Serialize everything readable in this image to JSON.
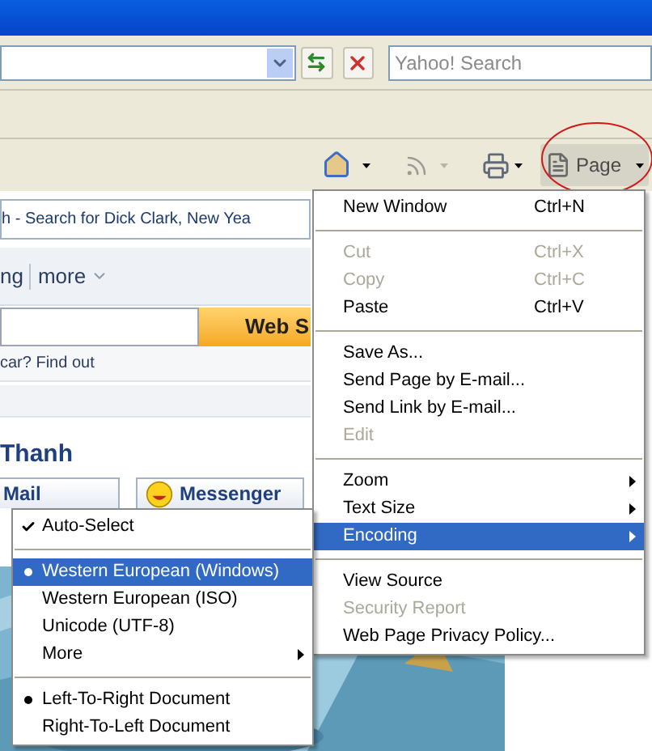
{
  "search_field": {
    "placeholder": "Yahoo! Search"
  },
  "command_bar": {
    "page_button": "Page"
  },
  "page": {
    "tab_title": "h - Search for Dick Clark, New Yea",
    "nav": [
      {
        "label": "ng"
      },
      {
        "label": "more"
      }
    ],
    "search_button": "Web S",
    "promo": "car? Find out",
    "greeting": "Thanh",
    "buttons": [
      {
        "label": "Mail",
        "kind": "mail"
      },
      {
        "label": "Messenger",
        "kind": "messenger"
      }
    ]
  },
  "menu": [
    {
      "kind": "item",
      "label": "New Window",
      "shortcut": "Ctrl+N",
      "disabled": false,
      "selected": false
    },
    {
      "kind": "separator"
    },
    {
      "kind": "item",
      "label": "Cut",
      "shortcut": "Ctrl+X",
      "disabled": true,
      "selected": false
    },
    {
      "kind": "item",
      "label": "Copy",
      "shortcut": "Ctrl+C",
      "disabled": true,
      "selected": false
    },
    {
      "kind": "item",
      "label": "Paste",
      "shortcut": "Ctrl+V",
      "disabled": false,
      "selected": false
    },
    {
      "kind": "separator"
    },
    {
      "kind": "item",
      "label": "Save As...",
      "disabled": false,
      "selected": false
    },
    {
      "kind": "item",
      "label": "Send Page by E-mail...",
      "disabled": false,
      "selected": false
    },
    {
      "kind": "item",
      "label": "Send Link by E-mail...",
      "disabled": false,
      "selected": false
    },
    {
      "kind": "item",
      "label": "Edit",
      "disabled": true,
      "selected": false
    },
    {
      "kind": "separator"
    },
    {
      "kind": "submenu",
      "label": "Zoom",
      "disabled": false,
      "selected": false
    },
    {
      "kind": "submenu",
      "label": "Text Size",
      "disabled": false,
      "selected": false
    },
    {
      "kind": "submenu",
      "label": "Encoding",
      "disabled": false,
      "selected": true
    },
    {
      "kind": "separator"
    },
    {
      "kind": "item",
      "label": "View Source",
      "disabled": false,
      "selected": false
    },
    {
      "kind": "item",
      "label": "Security Report",
      "disabled": true,
      "selected": false
    },
    {
      "kind": "item",
      "label": "Web Page Privacy Policy...",
      "disabled": false,
      "selected": false
    }
  ],
  "encoding_menu": [
    {
      "kind": "check",
      "label": "Auto-Select",
      "checked": true,
      "selected": false
    },
    {
      "kind": "separator"
    },
    {
      "kind": "radio",
      "label": "Western European (Windows)",
      "checked": true,
      "selected": true
    },
    {
      "kind": "radio",
      "label": "Western European (ISO)",
      "checked": false,
      "selected": false
    },
    {
      "kind": "radio",
      "label": "Unicode (UTF-8)",
      "checked": false,
      "selected": false
    },
    {
      "kind": "submenu",
      "label": "More",
      "selected": false
    },
    {
      "kind": "separator"
    },
    {
      "kind": "radio",
      "label": "Left-To-Right Document",
      "checked": true,
      "selected": false
    },
    {
      "kind": "radio",
      "label": "Right-To-Left Document",
      "checked": false,
      "selected": false
    }
  ]
}
